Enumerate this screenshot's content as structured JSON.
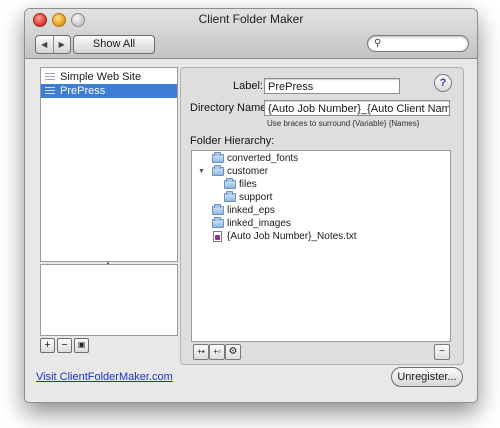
{
  "window": {
    "title": "Client Folder Maker",
    "show_all_label": "Show All",
    "search_placeholder": "",
    "back_icon": "◀",
    "forward_icon": "▶",
    "search_icon": "🔍"
  },
  "sidebar": {
    "items": [
      {
        "label": "Simple Web Site",
        "selected": false
      },
      {
        "label": "PrePress",
        "selected": true
      }
    ],
    "add_label": "+",
    "remove_label": "−",
    "action_label": "▣"
  },
  "form": {
    "label_label": "Label:",
    "label_value": "PrePress",
    "dir_label": "Directory Name:",
    "dir_value": "{Auto Job Number}_{Auto Client Name}",
    "hint": "Use braces to surround {Variable} {Names}",
    "hierarchy_label": "Folder Hierarchy:",
    "help_label": "?"
  },
  "tree": {
    "items": [
      {
        "label": "converted_fonts",
        "type": "folder"
      },
      {
        "label": "customer",
        "type": "folder"
      },
      {
        "label": "files",
        "type": "folder"
      },
      {
        "label": "support",
        "type": "folder"
      },
      {
        "label": "linked_eps",
        "type": "folder"
      },
      {
        "label": "linked_images",
        "type": "folder"
      },
      {
        "label": "{Auto Job Number}_Notes.txt",
        "type": "file"
      }
    ],
    "disclosure_expanded": "▼",
    "add_folder_label": "+▪",
    "add_file_label": "+▫",
    "action_label": "⚙",
    "remove_label": "−"
  },
  "footer": {
    "link_text": "Visit ClientFolderMaker.com",
    "unregister_label": "Unregister..."
  },
  "colors": {
    "selection": "#3f7cd4",
    "link": "#1a32c8",
    "help_accent": "#5c2aa8"
  }
}
